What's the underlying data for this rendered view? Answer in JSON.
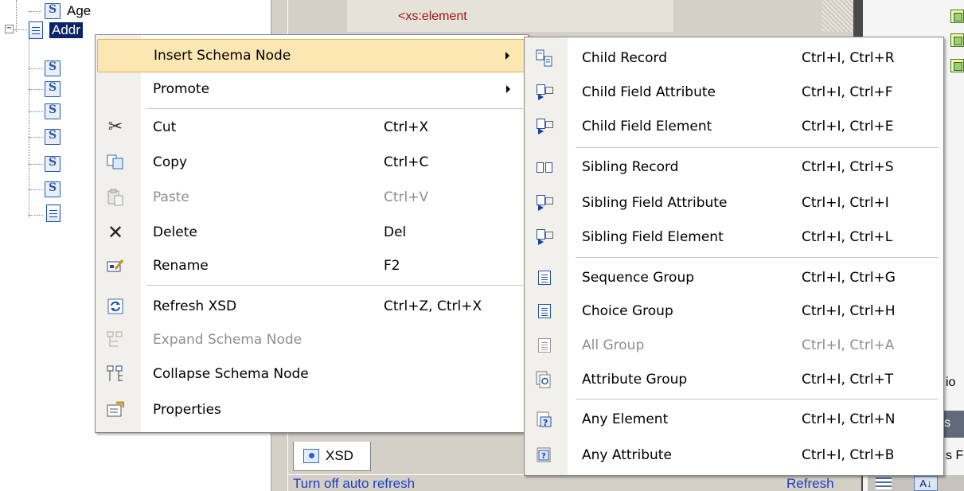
{
  "tree": {
    "items": [
      {
        "label": "Age",
        "selected": false
      },
      {
        "label": "Addr",
        "selected": true
      }
    ],
    "expander_symbol": "−"
  },
  "editor": {
    "code_fragment": "<xs:element"
  },
  "right_panel": {
    "tab_fragment": "s",
    "fragment_a": "io",
    "fragment_b": "s F",
    "az_label": "A↓"
  },
  "bottom": {
    "tab_label": "XSD",
    "status_left": "Turn off auto refresh",
    "status_right": "Refresh"
  },
  "main_menu": {
    "items": [
      {
        "label": "Insert Schema Node",
        "shortcut": "",
        "icon": "",
        "submenu": true,
        "highlighted": true,
        "enabled": true
      },
      {
        "label": "Promote",
        "shortcut": "",
        "icon": "",
        "submenu": true,
        "highlighted": false,
        "enabled": true
      },
      {
        "label": "Cut",
        "shortcut": "Ctrl+X",
        "icon": "scissors-icon",
        "submenu": false,
        "highlighted": false,
        "enabled": true
      },
      {
        "label": "Copy",
        "shortcut": "Ctrl+C",
        "icon": "copy-icon",
        "submenu": false,
        "highlighted": false,
        "enabled": true
      },
      {
        "label": "Paste",
        "shortcut": "Ctrl+V",
        "icon": "paste-icon",
        "submenu": false,
        "highlighted": false,
        "enabled": false
      },
      {
        "label": "Delete",
        "shortcut": "Del",
        "icon": "delete-icon",
        "submenu": false,
        "highlighted": false,
        "enabled": true
      },
      {
        "label": "Rename",
        "shortcut": "F2",
        "icon": "rename-icon",
        "submenu": false,
        "highlighted": false,
        "enabled": true
      },
      {
        "label": "Refresh XSD",
        "shortcut": "Ctrl+Z, Ctrl+X",
        "icon": "refresh-icon",
        "submenu": false,
        "highlighted": false,
        "enabled": true
      },
      {
        "label": "Expand Schema Node",
        "shortcut": "",
        "icon": "expand-node-icon",
        "submenu": false,
        "highlighted": false,
        "enabled": false
      },
      {
        "label": "Collapse Schema Node",
        "shortcut": "",
        "icon": "collapse-node-icon",
        "submenu": false,
        "highlighted": false,
        "enabled": true
      },
      {
        "label": "Properties",
        "shortcut": "",
        "icon": "properties-icon",
        "submenu": false,
        "highlighted": false,
        "enabled": true
      }
    ]
  },
  "sub_menu": {
    "items": [
      {
        "label": "Child Record",
        "shortcut": "Ctrl+I, Ctrl+R",
        "icon": "child-record-icon",
        "enabled": true
      },
      {
        "label": "Child Field Attribute",
        "shortcut": "Ctrl+I, Ctrl+F",
        "icon": "child-field-attribute-icon",
        "enabled": true
      },
      {
        "label": "Child Field Element",
        "shortcut": "Ctrl+I, Ctrl+E",
        "icon": "child-field-element-icon",
        "enabled": true
      },
      {
        "label": "Sibling Record",
        "shortcut": "Ctrl+I, Ctrl+S",
        "icon": "sibling-record-icon",
        "enabled": true
      },
      {
        "label": "Sibling Field Attribute",
        "shortcut": "Ctrl+I, Ctrl+I",
        "icon": "sibling-field-attribute-icon",
        "enabled": true
      },
      {
        "label": "Sibling Field Element",
        "shortcut": "Ctrl+I, Ctrl+L",
        "icon": "sibling-field-element-icon",
        "enabled": true
      },
      {
        "label": "Sequence Group",
        "shortcut": "Ctrl+I, Ctrl+G",
        "icon": "sequence-group-icon",
        "enabled": true
      },
      {
        "label": "Choice Group",
        "shortcut": "Ctrl+I, Ctrl+H",
        "icon": "choice-group-icon",
        "enabled": true
      },
      {
        "label": "All Group",
        "shortcut": "Ctrl+I, Ctrl+A",
        "icon": "all-group-icon",
        "enabled": false
      },
      {
        "label": "Attribute Group",
        "shortcut": "Ctrl+I, Ctrl+T",
        "icon": "attribute-group-icon",
        "enabled": true
      },
      {
        "label": "Any Element",
        "shortcut": "Ctrl+I, Ctrl+N",
        "icon": "any-element-icon",
        "enabled": true
      },
      {
        "label": "Any Attribute",
        "shortcut": "Ctrl+I, Ctrl+B",
        "icon": "any-attribute-icon",
        "enabled": true
      }
    ]
  }
}
